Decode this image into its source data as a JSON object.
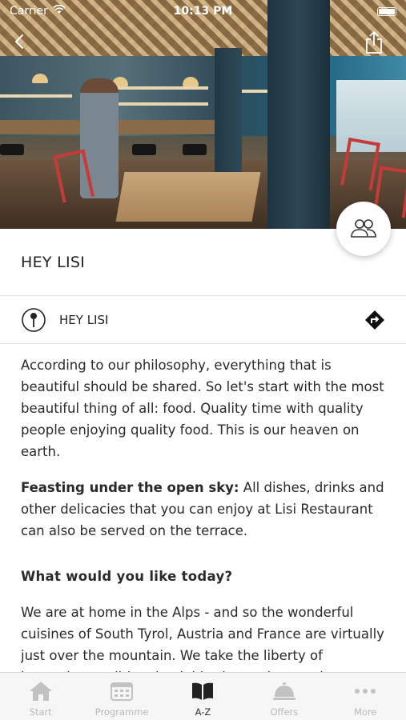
{
  "status_bar": {
    "carrier": "Carrier",
    "time": "10:13 PM"
  },
  "header": {
    "title": "HEY LISI"
  },
  "location": {
    "name": "HEY LISI"
  },
  "content": {
    "intro": "According to our philosophy, everything that is beautiful should be shared. So let's start with the most beautiful thing of all: food. Quality time with quality people enjoying quality food. This is our heaven on earth.",
    "feasting_label": "Feasting under the open sky:",
    "feasting_text": " All dishes, drinks and other delicacies that you can enjoy at Lisi Restaurant can also be served on the terrace.",
    "section_heading": "What would you like today?",
    "alps_text": "We are at home in the Alps - and so the wonderful cuisines of South Tyrol, Austria and France are virtually just over the mountain. We take the liberty of borrowing traditional neighboring recipes and"
  },
  "tabbar": {
    "items": [
      {
        "label": "Start",
        "icon": "house-icon",
        "active": false
      },
      {
        "label": "Programme",
        "icon": "calendar-icon",
        "active": false
      },
      {
        "label": "A-Z",
        "icon": "book-icon",
        "active": true
      },
      {
        "label": "Offers",
        "icon": "service-bell-icon",
        "active": false
      },
      {
        "label": "More",
        "icon": "more-dots-icon",
        "active": false
      }
    ]
  },
  "colors": {
    "active_tab": "#333333",
    "inactive_tab": "#b9b9b9",
    "divider": "#e3e3e3"
  }
}
